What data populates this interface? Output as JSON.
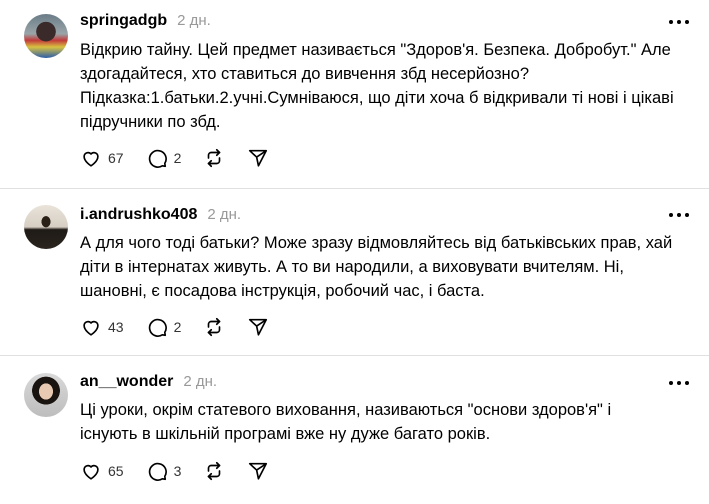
{
  "posts": [
    {
      "username": "springadgb",
      "time": "2 дн.",
      "lines": [
        "Відкрию тайну. Цей предмет називається \"Здоров'я. Безпека. Добробут.\" Але",
        "здогадайтеся, хто ставиться до вивчення збд несерйозно?",
        "Підказка:1.батьки.2.учні.Сумніваюся, що діти хоча б відкривали ті нові і цікаві",
        "підручники по збд."
      ],
      "likes": "67",
      "replies": "2"
    },
    {
      "username": "i.andrushko408",
      "time": "2 дн.",
      "lines": [
        "А для чого тоді батьки? Може зразу відмовляйтесь від батьківських прав, хай",
        "діти в інтернатах живуть. А то ви народили, а виховувати вчителям. Ні,",
        "шановні, є посадова інструкція, робочий час, і баста."
      ],
      "likes": "43",
      "replies": "2"
    },
    {
      "username": "an__wonder",
      "time": "2 дн.",
      "lines": [
        "Ці уроки, окрім статевого виховання, називаються \"основи здоров'я\" і",
        "існують в шкільній програмі вже ну дуже багато років."
      ],
      "likes": "65",
      "replies": "3"
    }
  ],
  "icons": {
    "like": "heart-icon",
    "reply": "comment-icon",
    "repost": "repost-icon",
    "share": "send-icon",
    "more": "more-icon"
  }
}
